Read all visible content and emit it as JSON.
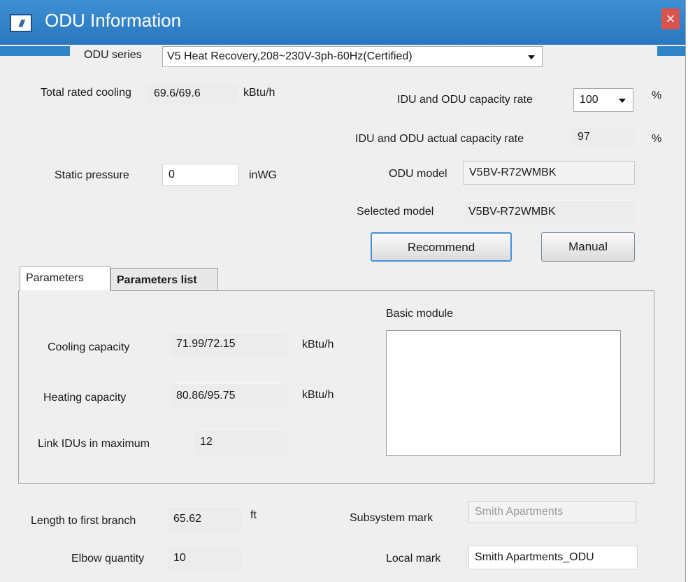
{
  "window": {
    "title": "ODU Information",
    "close_symbol": "×",
    "icon_text": "///"
  },
  "odu_series": {
    "label": "ODU series",
    "value": "V5 Heat Recovery,208~230V-3ph-60Hz(Certified)"
  },
  "total_rated_cooling": {
    "label": "Total rated cooling",
    "value": "69.6/69.6",
    "unit": "kBtu/h"
  },
  "capacity_rate": {
    "label": "IDU and ODU capacity rate",
    "value": "100",
    "unit": "%"
  },
  "actual_capacity_rate": {
    "label": "IDU and ODU actual capacity rate",
    "value": "97",
    "unit": "%"
  },
  "static_pressure": {
    "label": "Static pressure",
    "value": "0",
    "unit": "inWG"
  },
  "odu_model": {
    "label": "ODU model",
    "value": "V5BV-R72WMBK"
  },
  "selected_model": {
    "label": "Selected model",
    "value": "V5BV-R72WMBK"
  },
  "buttons": {
    "recommend": "Recommend",
    "manual": "Manual"
  },
  "tabs": [
    {
      "label": "Parameters"
    },
    {
      "label": "Parameters list"
    }
  ],
  "parameters": {
    "cooling_capacity": {
      "label": "Cooling capacity",
      "value": "71.99/72.15",
      "unit": "kBtu/h"
    },
    "heating_capacity": {
      "label": "Heating capacity",
      "value": "80.86/95.75",
      "unit": "kBtu/h"
    },
    "link_idus": {
      "label": "Link IDUs in maximum",
      "value": "12"
    },
    "basic_module": {
      "label": "Basic module"
    }
  },
  "length_first_branch": {
    "label": "Length to first branch",
    "value": "65.62",
    "unit": "ft"
  },
  "elbow_quantity": {
    "label": "Elbow quantity",
    "value": "10"
  },
  "subsystem_mark": {
    "label": "Subsystem mark",
    "value": "Smith Apartments"
  },
  "local_mark": {
    "label": "Local mark",
    "value": "Smith Apartments_ODU"
  },
  "colors": {
    "titlebar": "#2f80c8",
    "close": "#d9534f",
    "accent": "#4a8fd4"
  }
}
